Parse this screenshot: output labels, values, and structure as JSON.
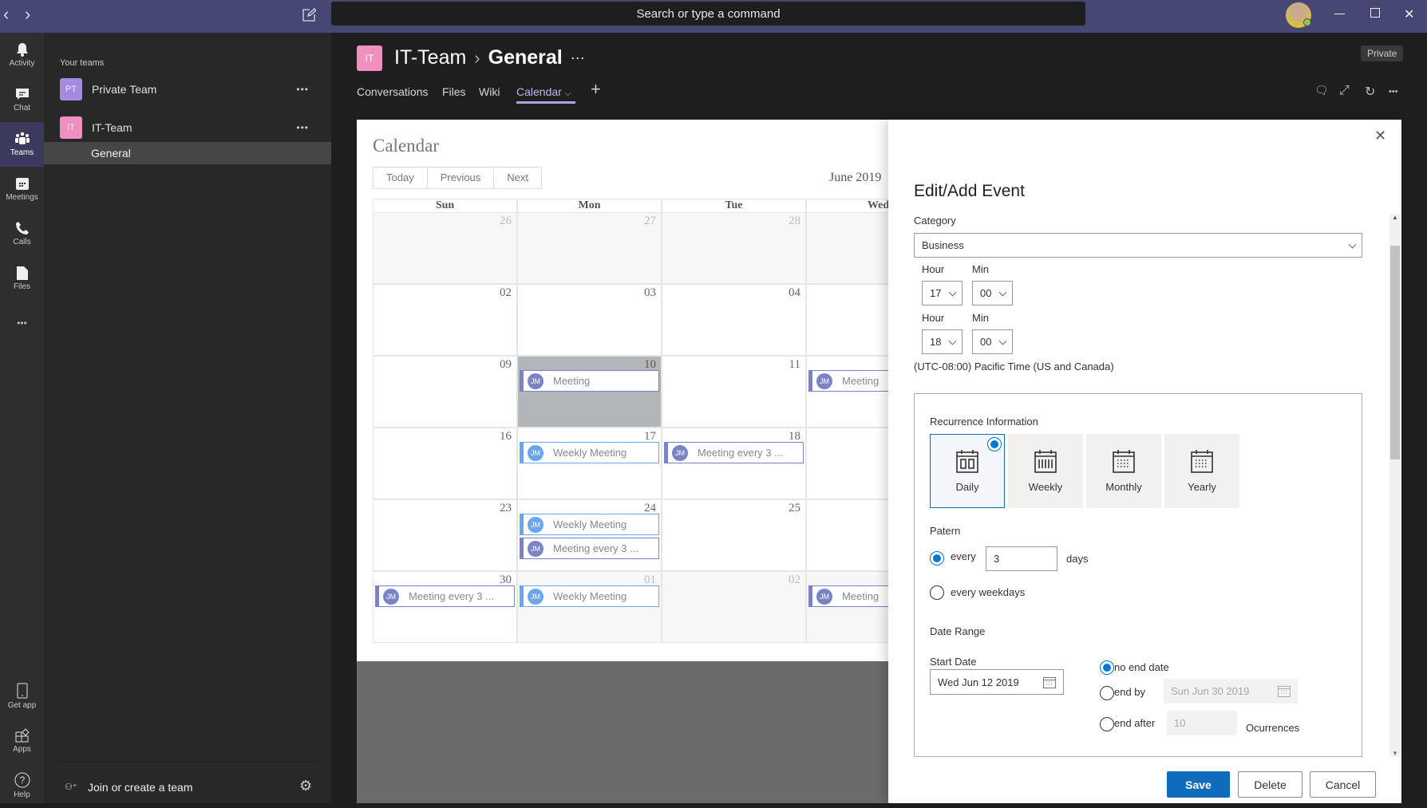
{
  "titlebar": {
    "search_placeholder": "Search or type a command"
  },
  "rail": {
    "items": [
      {
        "label": "Activity",
        "icon": "bell-icon"
      },
      {
        "label": "Chat",
        "icon": "chat-icon"
      },
      {
        "label": "Teams",
        "icon": "teams-icon",
        "active": true
      },
      {
        "label": "Meetings",
        "icon": "calendar-icon"
      },
      {
        "label": "Calls",
        "icon": "phone-icon"
      },
      {
        "label": "Files",
        "icon": "file-icon"
      }
    ],
    "bottom": [
      {
        "label": "Get app"
      },
      {
        "label": "Apps"
      },
      {
        "label": "Help"
      }
    ]
  },
  "teams_panel": {
    "heading": "Your teams",
    "teams": [
      {
        "initials": "PT",
        "name": "Private Team",
        "color": "#a58be0"
      },
      {
        "initials": "IT",
        "name": "IT-Team",
        "color": "#f08fc0"
      }
    ],
    "channel": "General",
    "join": "Join or create a team"
  },
  "header": {
    "team_initials": "IT",
    "team": "IT-Team",
    "channel": "General",
    "badge": "Private",
    "tabs": [
      "Conversations",
      "Files",
      "Wiki",
      "Calendar"
    ],
    "active_tab": "Calendar"
  },
  "calendar": {
    "title": "Calendar",
    "buttons": [
      "Today",
      "Previous",
      "Next"
    ],
    "month": "June 2019",
    "days": [
      "Sun",
      "Mon",
      "Tue",
      "Wed"
    ],
    "colors": {
      "meeting": "#7b83c7",
      "weekly": "#6aa6f0"
    },
    "avatar_initials": "JM",
    "weeks": [
      [
        {
          "n": "26",
          "muted": true
        },
        {
          "n": "27",
          "muted": true
        },
        {
          "n": "28",
          "muted": true
        },
        {
          "muted": true
        }
      ],
      [
        {
          "n": "02"
        },
        {
          "n": "03"
        },
        {
          "n": "04"
        },
        {}
      ],
      [
        {
          "n": "09"
        },
        {
          "n": "10",
          "hl": true,
          "events": [
            {
              "t": "Meeting",
              "k": "meeting"
            }
          ]
        },
        {
          "n": "11"
        },
        {
          "events": [
            {
              "t": "Meeting",
              "k": "meeting"
            }
          ]
        }
      ],
      [
        {
          "n": "16"
        },
        {
          "n": "17",
          "events": [
            {
              "t": "Weekly Meeting",
              "k": "weekly"
            }
          ]
        },
        {
          "n": "18",
          "events": [
            {
              "t": "Meeting every 3 ...",
              "k": "meeting"
            }
          ]
        },
        {}
      ],
      [
        {
          "n": "23"
        },
        {
          "n": "24",
          "events": [
            {
              "t": "Weekly Meeting",
              "k": "weekly"
            },
            {
              "t": "Meeting every 3 ...",
              "k": "meeting"
            }
          ]
        },
        {
          "n": "25"
        },
        {}
      ],
      [
        {
          "n": "30",
          "events": [
            {
              "t": "Meeting every 3 ...",
              "k": "meeting"
            }
          ]
        },
        {
          "n": "01",
          "muted": true,
          "events": [
            {
              "t": "Weekly Meeting",
              "k": "weekly"
            }
          ]
        },
        {
          "n": "02",
          "muted": true
        },
        {
          "muted": true,
          "events": [
            {
              "t": "Meeting",
              "k": "meeting"
            }
          ]
        }
      ]
    ]
  },
  "panel": {
    "title": "Edit/Add Event",
    "category_label": "Category",
    "category": "Business",
    "hour_label": "Hour",
    "min_label": "Min",
    "start_hour": "17",
    "start_min": "00",
    "end_hour": "18",
    "end_min": "00",
    "timezone": "(UTC-08:00) Pacific Time (US and Canada)",
    "recurrence_label": "Recurrence Information",
    "recurrence_options": [
      "Daily",
      "Weekly",
      "Monthly",
      "Yearly"
    ],
    "recurrence_selected": "Daily",
    "pattern_label": "Patern",
    "every": "every",
    "every_value": "3",
    "days": "days",
    "every_weekdays": "every weekdays",
    "date_range_label": "Date Range",
    "start_date_label": "Start Date",
    "start_date": "Wed Jun 12 2019",
    "no_end": "no end date",
    "end_by": "end by",
    "end_by_date": "Sun Jun 30 2019",
    "end_after": "end after",
    "occurrences_value": "10",
    "occurrences": "Ocurrences",
    "end_selected": "no end date",
    "save": "Save",
    "delete": "Delete",
    "cancel": "Cancel",
    "accent": "#0078d4"
  }
}
